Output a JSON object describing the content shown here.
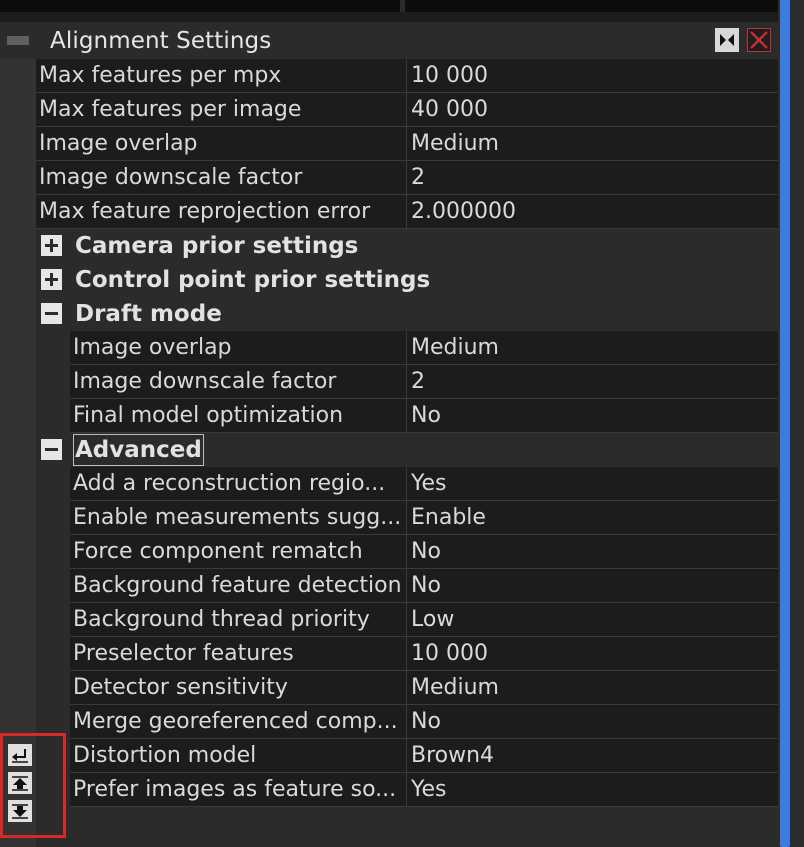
{
  "panel": {
    "title": "Alignment Settings"
  },
  "rows_top": [
    {
      "key": "Max features per mpx",
      "value": "10 000"
    },
    {
      "key": "Max features per image",
      "value": "40 000"
    },
    {
      "key": "Image overlap",
      "value": "Medium"
    },
    {
      "key": "Image downscale factor",
      "value": "2"
    },
    {
      "key": "Max feature reprojection error",
      "value": "2.000000"
    }
  ],
  "groups": {
    "camera_prior": {
      "label": "Camera prior settings",
      "state": "collapsed"
    },
    "control_point_prior": {
      "label": "Control point prior settings",
      "state": "collapsed"
    },
    "draft_mode": {
      "label": "Draft mode",
      "state": "expanded"
    },
    "advanced": {
      "label": "Advanced",
      "state": "expanded"
    }
  },
  "draft_rows": [
    {
      "key": "Image overlap",
      "value": "Medium"
    },
    {
      "key": "Image downscale factor",
      "value": "2"
    },
    {
      "key": "Final model optimization",
      "value": "No"
    }
  ],
  "advanced_rows": [
    {
      "key": "Add a reconstruction regio...",
      "value": "Yes"
    },
    {
      "key": "Enable measurements sugg...",
      "value": "Enable"
    },
    {
      "key": "Force component rematch",
      "value": "No"
    },
    {
      "key": "Background feature detection",
      "value": "No"
    },
    {
      "key": "Background thread priority",
      "value": "Low"
    },
    {
      "key": "Preselector features",
      "value": "10 000"
    },
    {
      "key": "Detector sensitivity",
      "value": "Medium"
    },
    {
      "key": "Merge georeferenced comp...",
      "value": "No"
    },
    {
      "key": "Distortion model",
      "value": "Brown4"
    },
    {
      "key": "Prefer images as feature so...",
      "value": "Yes"
    }
  ],
  "icons": {
    "dock": "dock-icon",
    "close": "close-icon",
    "collapse": "collapse-icon",
    "tools": [
      "back-icon",
      "move-up-icon",
      "move-down-icon"
    ]
  },
  "colors": {
    "accent_scrollbar": "#3d7be0",
    "highlight_box": "#d42a2a",
    "close_x": "#c03030"
  }
}
